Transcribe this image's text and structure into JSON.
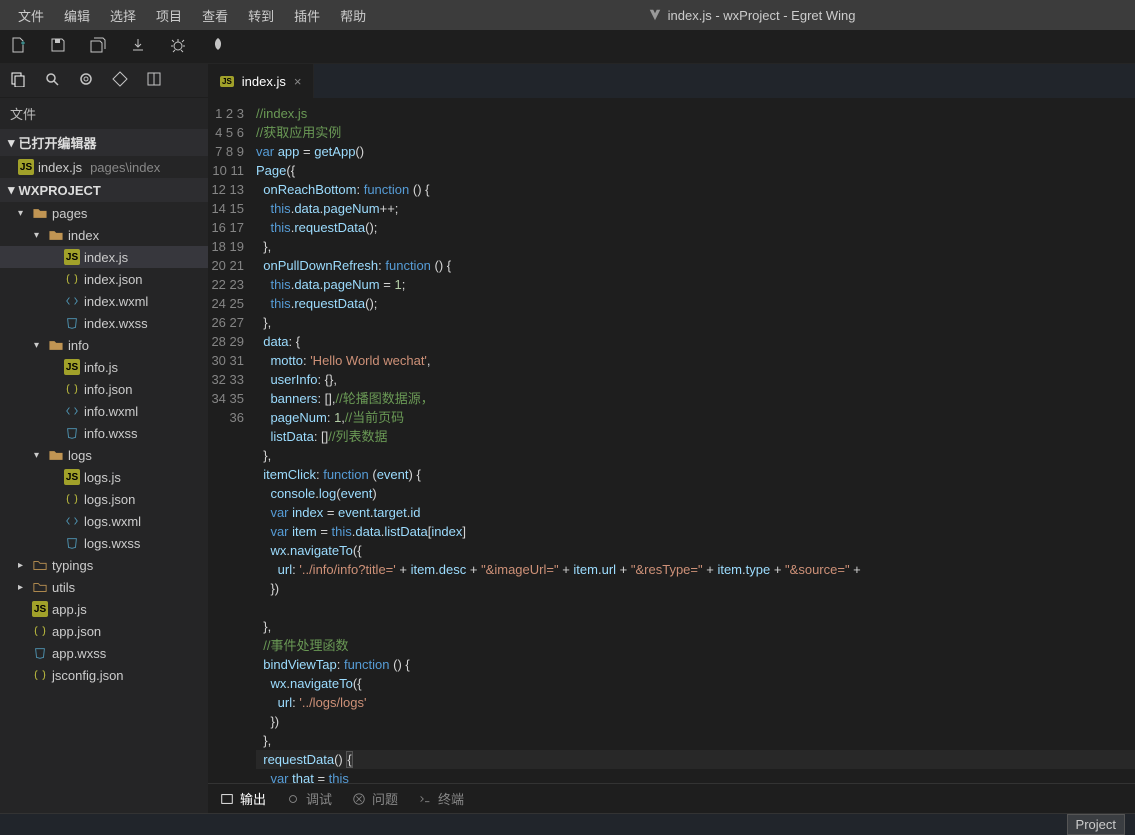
{
  "menu": [
    "文件",
    "编辑",
    "选择",
    "项目",
    "查看",
    "转到",
    "插件",
    "帮助"
  ],
  "window_title": "index.js - wxProject - Egret Wing",
  "sidebar": {
    "panel_label": "文件",
    "open_editors_label": "已打开编辑器",
    "open_editors": [
      {
        "name": "index.js",
        "path": "pages\\index"
      }
    ],
    "project_label": "WXPROJECT",
    "tree": [
      {
        "type": "folder",
        "name": "pages",
        "depth": 1,
        "open": true
      },
      {
        "type": "folder",
        "name": "index",
        "depth": 2,
        "open": true
      },
      {
        "type": "file",
        "name": "index.js",
        "depth": 3,
        "ext": "js",
        "selected": true
      },
      {
        "type": "file",
        "name": "index.json",
        "depth": 3,
        "ext": "json"
      },
      {
        "type": "file",
        "name": "index.wxml",
        "depth": 3,
        "ext": "wxml"
      },
      {
        "type": "file",
        "name": "index.wxss",
        "depth": 3,
        "ext": "wxss"
      },
      {
        "type": "folder",
        "name": "info",
        "depth": 2,
        "open": true
      },
      {
        "type": "file",
        "name": "info.js",
        "depth": 3,
        "ext": "js"
      },
      {
        "type": "file",
        "name": "info.json",
        "depth": 3,
        "ext": "json"
      },
      {
        "type": "file",
        "name": "info.wxml",
        "depth": 3,
        "ext": "wxml"
      },
      {
        "type": "file",
        "name": "info.wxss",
        "depth": 3,
        "ext": "wxss"
      },
      {
        "type": "folder",
        "name": "logs",
        "depth": 2,
        "open": true
      },
      {
        "type": "file",
        "name": "logs.js",
        "depth": 3,
        "ext": "js"
      },
      {
        "type": "file",
        "name": "logs.json",
        "depth": 3,
        "ext": "json"
      },
      {
        "type": "file",
        "name": "logs.wxml",
        "depth": 3,
        "ext": "wxml"
      },
      {
        "type": "file",
        "name": "logs.wxss",
        "depth": 3,
        "ext": "wxss"
      },
      {
        "type": "folder",
        "name": "typings",
        "depth": 1,
        "open": false
      },
      {
        "type": "folder",
        "name": "utils",
        "depth": 1,
        "open": false
      },
      {
        "type": "file",
        "name": "app.js",
        "depth": 1,
        "ext": "js"
      },
      {
        "type": "file",
        "name": "app.json",
        "depth": 1,
        "ext": "json"
      },
      {
        "type": "file",
        "name": "app.wxss",
        "depth": 1,
        "ext": "wxss"
      },
      {
        "type": "file",
        "name": "jsconfig.json",
        "depth": 1,
        "ext": "json"
      }
    ]
  },
  "tab": {
    "name": "index.js"
  },
  "code_lines": [
    {
      "n": 1,
      "html": "<span class='tok-com'>//index.js</span>"
    },
    {
      "n": 2,
      "html": "<span class='tok-com'>//获取应用实例</span>"
    },
    {
      "n": 3,
      "html": "<span class='tok-kw'>var</span> <span class='tok-id'>app</span> = <span class='tok-id'>getApp</span>()"
    },
    {
      "n": 4,
      "html": "<span class='tok-id'>Page</span>({"
    },
    {
      "n": 5,
      "html": "  <span class='tok-prop'>onReachBottom</span>: <span class='tok-kw'>function</span> () {"
    },
    {
      "n": 6,
      "html": "    <span class='tok-this'>this</span>.<span class='tok-prop'>data</span>.<span class='tok-prop'>pageNum</span>++;"
    },
    {
      "n": 7,
      "html": "    <span class='tok-this'>this</span>.<span class='tok-id'>requestData</span>();"
    },
    {
      "n": 8,
      "html": "  },"
    },
    {
      "n": 9,
      "html": "  <span class='tok-prop'>onPullDownRefresh</span>: <span class='tok-kw'>function</span> () {"
    },
    {
      "n": 10,
      "html": "    <span class='tok-this'>this</span>.<span class='tok-prop'>data</span>.<span class='tok-prop'>pageNum</span> = <span class='tok-num'>1</span>;"
    },
    {
      "n": 11,
      "html": "    <span class='tok-this'>this</span>.<span class='tok-id'>requestData</span>();"
    },
    {
      "n": 12,
      "html": "  },"
    },
    {
      "n": 13,
      "html": "  <span class='tok-prop'>data</span>: {"
    },
    {
      "n": 14,
      "html": "    <span class='tok-prop'>motto</span>: <span class='tok-str'>'Hello World wechat'</span>,"
    },
    {
      "n": 15,
      "html": "    <span class='tok-prop'>userInfo</span>: {},"
    },
    {
      "n": 16,
      "html": "    <span class='tok-prop'>banners</span>: [],<span class='tok-com'>//轮播图数据源，</span>"
    },
    {
      "n": 17,
      "html": "    <span class='tok-prop'>pageNum</span>: <span class='tok-num'>1</span>,<span class='tok-com'>//当前页码</span>"
    },
    {
      "n": 18,
      "html": "    <span class='tok-prop'>listData</span>: []<span class='tok-com'>//列表数据</span>"
    },
    {
      "n": 19,
      "html": "  },"
    },
    {
      "n": 20,
      "html": "  <span class='tok-prop'>itemClick</span>: <span class='tok-kw'>function</span> (<span class='tok-id'>event</span>) {"
    },
    {
      "n": 21,
      "html": "    <span class='tok-id'>console</span>.<span class='tok-id'>log</span>(<span class='tok-id'>event</span>)"
    },
    {
      "n": 22,
      "html": "    <span class='tok-kw'>var</span> <span class='tok-id'>index</span> = <span class='tok-id'>event</span>.<span class='tok-prop'>target</span>.<span class='tok-prop'>id</span>"
    },
    {
      "n": 23,
      "html": "    <span class='tok-kw'>var</span> <span class='tok-id'>item</span> = <span class='tok-this'>this</span>.<span class='tok-prop'>data</span>.<span class='tok-prop'>listData</span>[<span class='tok-id'>index</span>]"
    },
    {
      "n": 24,
      "html": "    <span class='tok-id'>wx</span>.<span class='tok-id'>navigateTo</span>({"
    },
    {
      "n": 25,
      "html": "      <span class='tok-prop'>url</span>: <span class='tok-str'>'../info/info?title='</span> + <span class='tok-id'>item</span>.<span class='tok-prop'>desc</span> + <span class='tok-str'>\"&imageUrl=\"</span> + <span class='tok-id'>item</span>.<span class='tok-prop'>url</span> + <span class='tok-str'>\"&resType=\"</span> + <span class='tok-id'>item</span>.<span class='tok-prop'>type</span> + <span class='tok-str'>\"&source=\"</span> + "
    },
    {
      "n": 26,
      "html": "    })"
    },
    {
      "n": 27,
      "html": ""
    },
    {
      "n": 28,
      "html": "  },"
    },
    {
      "n": 29,
      "html": "  <span class='tok-com'>//事件处理函数</span>"
    },
    {
      "n": 30,
      "html": "  <span class='tok-prop'>bindViewTap</span>: <span class='tok-kw'>function</span> () {"
    },
    {
      "n": 31,
      "html": "    <span class='tok-id'>wx</span>.<span class='tok-id'>navigateTo</span>({"
    },
    {
      "n": 32,
      "html": "      <span class='tok-prop'>url</span>: <span class='tok-str'>'../logs/logs'</span>"
    },
    {
      "n": 33,
      "html": "    })"
    },
    {
      "n": 34,
      "html": "  },"
    },
    {
      "n": 35,
      "html": "  <span class='tok-id'>requestData</span>() <span style='background:#333;border:1px solid #555'>{</span>",
      "cursor": true
    },
    {
      "n": 36,
      "html": "    <span class='tok-kw'>var</span> <span class='tok-id'>that</span> = <span class='tok-this'>this</span>"
    }
  ],
  "bottom_tabs": {
    "output": "输出",
    "debug": "调试",
    "problems": "问题",
    "terminal": "终端"
  },
  "status": {
    "project": "Project"
  }
}
